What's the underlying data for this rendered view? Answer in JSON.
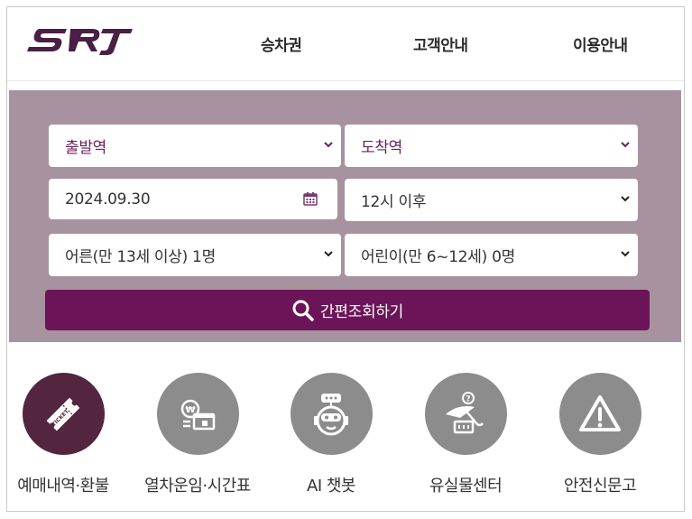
{
  "header": {
    "logo_text": "SRT",
    "nav": [
      {
        "label": "승차권"
      },
      {
        "label": "고객안내"
      },
      {
        "label": "이용안내"
      }
    ]
  },
  "search": {
    "departure": {
      "value": "출발역"
    },
    "arrival": {
      "value": "도착역"
    },
    "date": {
      "value": "2024.09.30"
    },
    "time": {
      "value": "12시 이후"
    },
    "adults": {
      "value": "어른(만 13세 이상) 1명"
    },
    "children": {
      "value": "어린이(만 6~12세) 0명"
    },
    "submit_label": "간편조회하기"
  },
  "shortcuts": [
    {
      "label": "예매내역·환불",
      "icon": "ticket-icon"
    },
    {
      "label": "열차운임·시간표",
      "icon": "fare-timetable-icon"
    },
    {
      "label": "AI 챗봇",
      "icon": "chatbot-icon"
    },
    {
      "label": "유실물센터",
      "icon": "lost-and-found-icon"
    },
    {
      "label": "안전신문고",
      "icon": "warning-icon"
    }
  ],
  "colors": {
    "brand": "#6b1558",
    "panel": "#a7929f",
    "active_circle": "#53253f",
    "circle": "#8c8c8c"
  }
}
